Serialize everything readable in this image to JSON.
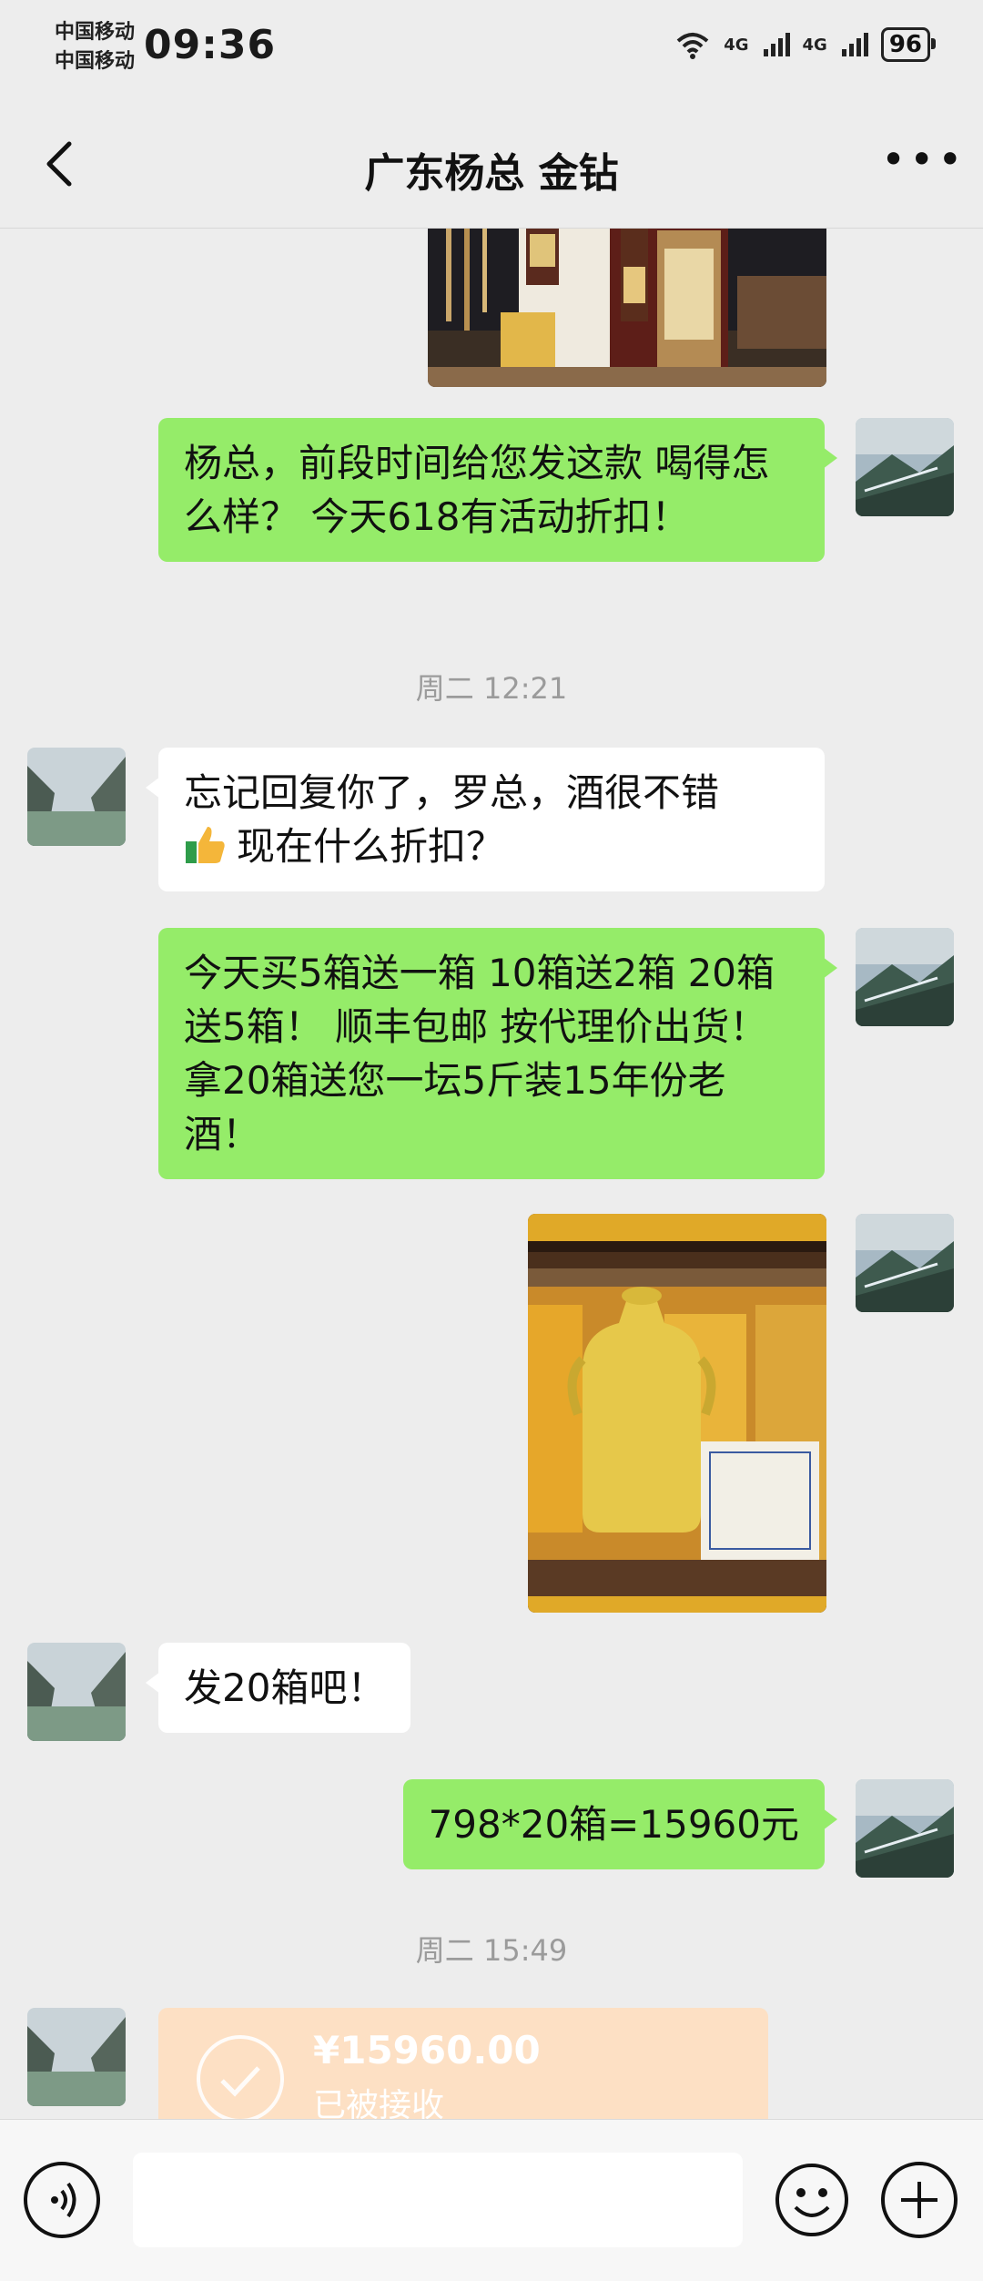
{
  "status": {
    "carrier1": "中国移动",
    "carrier2": "中国移动",
    "time": "09:36",
    "net1": "4G",
    "net2": "4G",
    "battery": "96"
  },
  "header": {
    "title": "广东杨总 金钻"
  },
  "messages": {
    "m1": "杨总，前段时间给您发这款 喝得怎么样？ 今天618有活动折扣！",
    "time1": "周二 12:21",
    "m2a": "忘记回复你了，罗总，酒很不错",
    "m2b": "现在什么折扣？",
    "m3": "今天买5箱送一箱 10箱送2箱 20箱送5箱！ 顺丰包邮 按代理价出货！拿20箱送您一坛5斤装15年份老酒！",
    "m4": "发20箱吧！",
    "m5": "798*20箱=15960元",
    "time2": "周二 15:49"
  },
  "transfer": {
    "amount": "¥15960.00",
    "status": "已被接收"
  },
  "colors": {
    "sent_bubble": "#95ec69",
    "received_bubble": "#ffffff",
    "transfer": "#fde0c4",
    "background": "#ededed"
  },
  "icons": [
    "back-arrow-icon",
    "more-icon",
    "voice-icon",
    "emoji-icon",
    "plus-icon",
    "wifi-icon",
    "signal-icon",
    "battery-icon",
    "check-circle-icon",
    "thumbs-up-icon"
  ]
}
